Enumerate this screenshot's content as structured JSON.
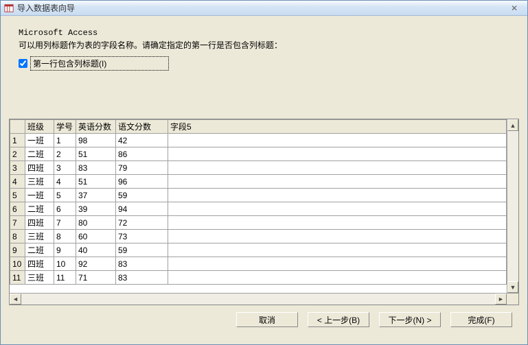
{
  "titlebar": {
    "title": "导入数据表向导",
    "close_glyph": "✕"
  },
  "intro": {
    "product": "Microsoft Access",
    "instruction": "可以用列标题作为表的字段名称。请确定指定的第一行是否包含列标题："
  },
  "checkbox": {
    "label": "第一行包含列标题(I)",
    "checked": true
  },
  "grid": {
    "headers": [
      "班级",
      "学号",
      "英语分数",
      "语文分数",
      "字段5"
    ],
    "rows": [
      {
        "n": 1,
        "c": [
          "一班",
          "1",
          "98",
          "42",
          ""
        ]
      },
      {
        "n": 2,
        "c": [
          "二班",
          "2",
          "51",
          "86",
          ""
        ]
      },
      {
        "n": 3,
        "c": [
          "四班",
          "3",
          "83",
          "79",
          ""
        ]
      },
      {
        "n": 4,
        "c": [
          "三班",
          "4",
          "51",
          "96",
          ""
        ]
      },
      {
        "n": 5,
        "c": [
          "一班",
          "5",
          "37",
          "59",
          ""
        ]
      },
      {
        "n": 6,
        "c": [
          "二班",
          "6",
          "39",
          "94",
          ""
        ]
      },
      {
        "n": 7,
        "c": [
          "四班",
          "7",
          "80",
          "72",
          ""
        ]
      },
      {
        "n": 8,
        "c": [
          "三班",
          "8",
          "60",
          "73",
          ""
        ]
      },
      {
        "n": 9,
        "c": [
          "二班",
          "9",
          "40",
          "59",
          ""
        ]
      },
      {
        "n": 10,
        "c": [
          "四班",
          "10",
          "92",
          "83",
          ""
        ]
      },
      {
        "n": 11,
        "c": [
          "三班",
          "11",
          "71",
          "83",
          ""
        ]
      }
    ]
  },
  "footer": {
    "cancel": "取消",
    "back": "< 上一步(B)",
    "next": "下一步(N) >",
    "finish": "完成(F)"
  }
}
